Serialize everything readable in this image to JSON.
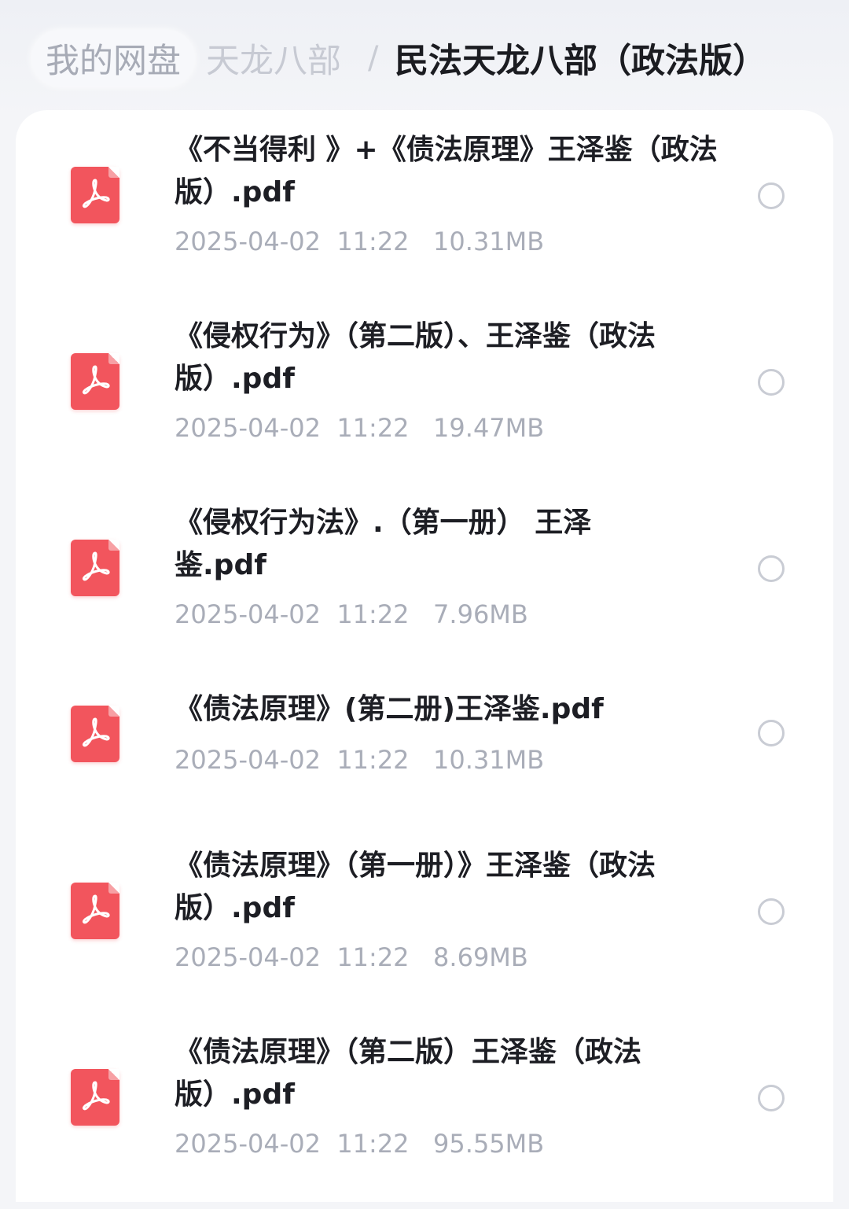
{
  "breadcrumb": {
    "root": "我的网盘",
    "parent": "天龙八部",
    "separator": "/",
    "current": "民法天龙八部（政法版）"
  },
  "files": [
    {
      "name": "《不当得利 》+《债法原理》王泽鉴（政法版）.pdf",
      "date": "2025-04-02",
      "time": "11:22",
      "size": "10.31MB",
      "icon": "pdf-icon"
    },
    {
      "name": "《侵权行为》（第二版）、王泽鉴（政法版）.pdf",
      "date": "2025-04-02",
      "time": "11:22",
      "size": "19.47MB",
      "icon": "pdf-icon"
    },
    {
      "name": "《侵权行为法》.（第一册） 王泽鉴.pdf",
      "date": "2025-04-02",
      "time": "11:22",
      "size": "7.96MB",
      "icon": "pdf-icon"
    },
    {
      "name": "《债法原理》(第二册)王泽鉴.pdf",
      "date": "2025-04-02",
      "time": "11:22",
      "size": "10.31MB",
      "icon": "pdf-icon"
    },
    {
      "name": "《债法原理》（第一册）》王泽鉴（政法版）.pdf",
      "date": "2025-04-02",
      "time": "11:22",
      "size": "8.69MB",
      "icon": "pdf-icon"
    },
    {
      "name": "《债法原理》（第二版）王泽鉴（政法版）.pdf",
      "date": "2025-04-02",
      "time": "11:22",
      "size": "95.55MB",
      "icon": "pdf-icon"
    }
  ],
  "colors": {
    "pdf_icon": "#f2555d",
    "meta_text": "#a9adb8",
    "title_text": "#1d1e24"
  }
}
